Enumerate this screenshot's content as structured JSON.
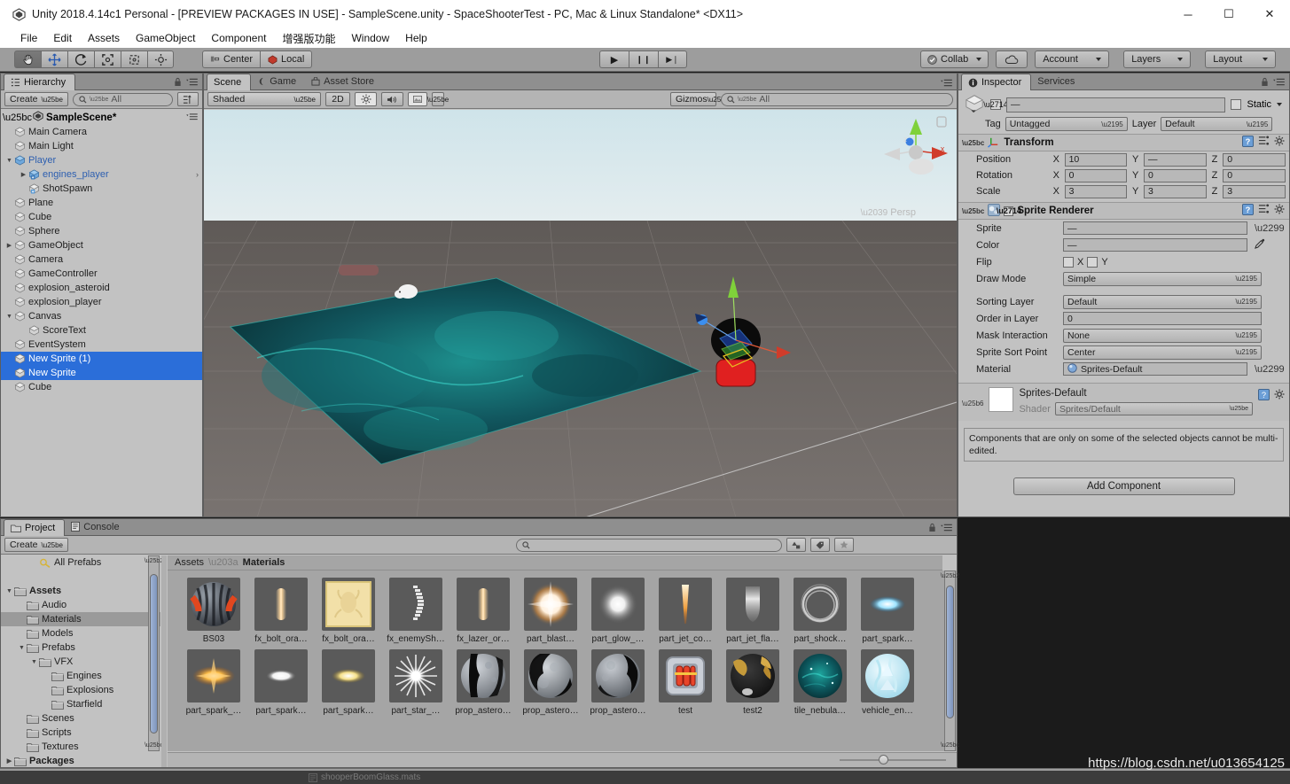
{
  "window": {
    "title": "Unity 2018.4.14c1 Personal - [PREVIEW PACKAGES IN USE] - SampleScene.unity - SpaceShooterTest - PC, Mac & Linux Standalone* <DX11>",
    "minimize": "─",
    "maximize": "☐",
    "close": "✕"
  },
  "menu": {
    "items": [
      "File",
      "Edit",
      "Assets",
      "GameObject",
      "Component",
      "增强版功能",
      "Window",
      "Help"
    ]
  },
  "toolbar": {
    "tools": [
      {
        "name": "hand-tool",
        "glyph": "✋",
        "active": true
      },
      {
        "name": "move-tool",
        "glyph": "✥",
        "active": false
      },
      {
        "name": "rotate-tool",
        "glyph": "↻",
        "active": false
      },
      {
        "name": "scale-tool",
        "glyph": "⤡",
        "active": false
      },
      {
        "name": "rect-tool",
        "glyph": "⬚",
        "active": false
      },
      {
        "name": "transform-tool",
        "glyph": "⬡",
        "active": false
      }
    ],
    "pivot_mode": "Center",
    "pivot_rotation": "Local",
    "play": "▶",
    "pause": "❙❙",
    "step": "▶❘",
    "collab": "Collab",
    "cloud": "☁",
    "account": "Account",
    "layers": "Layers",
    "layout": "Layout"
  },
  "hierarchy": {
    "tab": "Hierarchy",
    "create": "Create",
    "search_placeholder": "All",
    "scene_name": "SampleScene*",
    "items": [
      {
        "label": "Main Camera",
        "depth": 1,
        "arrow": "",
        "selected": false,
        "blue": false
      },
      {
        "label": "Main Light",
        "depth": 1,
        "arrow": "",
        "selected": false,
        "blue": false
      },
      {
        "label": "Player",
        "depth": 1,
        "arrow": "down",
        "selected": false,
        "blue": true
      },
      {
        "label": "engines_player",
        "depth": 2,
        "arrow": "right",
        "selected": false,
        "blue": true,
        "chevron": "›"
      },
      {
        "label": "ShotSpawn",
        "depth": 2,
        "arrow": "",
        "selected": false,
        "blue": false
      },
      {
        "label": "Plane",
        "depth": 1,
        "arrow": "",
        "selected": false,
        "blue": false
      },
      {
        "label": "Cube",
        "depth": 1,
        "arrow": "",
        "selected": false,
        "blue": false
      },
      {
        "label": "Sphere",
        "depth": 1,
        "arrow": "",
        "selected": false,
        "blue": false
      },
      {
        "label": "GameObject",
        "depth": 1,
        "arrow": "right",
        "selected": false,
        "blue": false
      },
      {
        "label": "Camera",
        "depth": 1,
        "arrow": "",
        "selected": false,
        "blue": false
      },
      {
        "label": "GameController",
        "depth": 1,
        "arrow": "",
        "selected": false,
        "blue": false
      },
      {
        "label": "explosion_asteroid",
        "depth": 1,
        "arrow": "",
        "selected": false,
        "blue": false
      },
      {
        "label": "explosion_player",
        "depth": 1,
        "arrow": "",
        "selected": false,
        "blue": false
      },
      {
        "label": "Canvas",
        "depth": 1,
        "arrow": "down",
        "selected": false,
        "blue": false
      },
      {
        "label": "ScoreText",
        "depth": 2,
        "arrow": "",
        "selected": false,
        "blue": false
      },
      {
        "label": "EventSystem",
        "depth": 1,
        "arrow": "",
        "selected": false,
        "blue": false
      },
      {
        "label": "New Sprite (1)",
        "depth": 1,
        "arrow": "",
        "selected": true,
        "blue": false
      },
      {
        "label": "New Sprite",
        "depth": 1,
        "arrow": "",
        "selected": true,
        "blue": false
      },
      {
        "label": "Cube",
        "depth": 1,
        "arrow": "",
        "selected": false,
        "blue": false
      }
    ]
  },
  "scene": {
    "tabs": [
      {
        "label": "Scene",
        "active": true
      },
      {
        "label": "Game",
        "active": false
      },
      {
        "label": "Asset Store",
        "active": false
      }
    ],
    "draw_mode": "Shaded",
    "two_d": "2D",
    "lighting_icon": "☀",
    "audio_icon": "◂))",
    "fx_icon": "⛰",
    "gizmos": "Gizmos",
    "search_placeholder": "All",
    "persp_label": "Persp",
    "axis_x": "x",
    "axis_y": "y",
    "axis_z": "z"
  },
  "inspector": {
    "tabs": [
      {
        "label": "Inspector",
        "active": true
      },
      {
        "label": "Services",
        "active": false
      }
    ],
    "enabled_checked": true,
    "name_value": "—",
    "static_label": "Static",
    "tag_label": "Tag",
    "tag_value": "Untagged",
    "layer_label": "Layer",
    "layer_value": "Default",
    "transform": {
      "title": "Transform",
      "rows": [
        {
          "label": "Position",
          "x": "10",
          "y": "—",
          "z": "0"
        },
        {
          "label": "Rotation",
          "x": "0",
          "y": "0",
          "z": "0"
        },
        {
          "label": "Scale",
          "x": "3",
          "y": "3",
          "z": "3"
        }
      ]
    },
    "sprite_renderer": {
      "title": "Sprite Renderer",
      "enabled": true,
      "sprite_label": "Sprite",
      "sprite_value": "—",
      "color_label": "Color",
      "color_value": "—",
      "flip_label": "Flip",
      "flip_x": "X",
      "flip_y": "Y",
      "draw_mode_label": "Draw Mode",
      "draw_mode_value": "Simple",
      "sorting_layer_label": "Sorting Layer",
      "sorting_layer_value": "Default",
      "order_label": "Order in Layer",
      "order_value": "0",
      "mask_label": "Mask Interaction",
      "mask_value": "None",
      "sort_point_label": "Sprite Sort Point",
      "sort_point_value": "Center",
      "material_label": "Material",
      "material_value": "Sprites-Default"
    },
    "material_preview": {
      "title": "Sprites-Default",
      "shader_label": "Shader",
      "shader_value": "Sprites/Default"
    },
    "multi_edit_note": "Components that are only on some of the selected objects cannot be multi-edited.",
    "add_component": "Add Component"
  },
  "project": {
    "tabs": [
      {
        "label": "Project",
        "active": true
      },
      {
        "label": "Console",
        "active": false
      }
    ],
    "create": "Create",
    "search_placeholder": "",
    "breadcrumb": [
      "Assets",
      "Materials"
    ],
    "tree": [
      {
        "label": "All Prefabs",
        "depth": 2,
        "arrow": "",
        "icon": "search",
        "bold": false,
        "selected": false
      },
      {
        "label": "",
        "depth": 0,
        "arrow": "",
        "icon": "none",
        "bold": false,
        "selected": false
      },
      {
        "label": "Assets",
        "depth": 0,
        "arrow": "down",
        "icon": "folder",
        "bold": true,
        "selected": false
      },
      {
        "label": "Audio",
        "depth": 1,
        "arrow": "",
        "icon": "folder",
        "bold": false,
        "selected": false
      },
      {
        "label": "Materials",
        "depth": 1,
        "arrow": "",
        "icon": "folder",
        "bold": false,
        "selected": true
      },
      {
        "label": "Models",
        "depth": 1,
        "arrow": "",
        "icon": "folder",
        "bold": false,
        "selected": false
      },
      {
        "label": "Prefabs",
        "depth": 1,
        "arrow": "down",
        "icon": "folder",
        "bold": false,
        "selected": false
      },
      {
        "label": "VFX",
        "depth": 2,
        "arrow": "down",
        "icon": "folder",
        "bold": false,
        "selected": false
      },
      {
        "label": "Engines",
        "depth": 3,
        "arrow": "",
        "icon": "folder",
        "bold": false,
        "selected": false
      },
      {
        "label": "Explosions",
        "depth": 3,
        "arrow": "",
        "icon": "folder",
        "bold": false,
        "selected": false
      },
      {
        "label": "Starfield",
        "depth": 3,
        "arrow": "",
        "icon": "folder",
        "bold": false,
        "selected": false
      },
      {
        "label": "Scenes",
        "depth": 1,
        "arrow": "",
        "icon": "folder",
        "bold": false,
        "selected": false
      },
      {
        "label": "Scripts",
        "depth": 1,
        "arrow": "",
        "icon": "folder",
        "bold": false,
        "selected": false
      },
      {
        "label": "Textures",
        "depth": 1,
        "arrow": "",
        "icon": "folder",
        "bold": false,
        "selected": false
      },
      {
        "label": "Packages",
        "depth": 0,
        "arrow": "right",
        "icon": "folder",
        "bold": true,
        "selected": false
      }
    ],
    "assets": [
      {
        "name": "BS03",
        "kind": "sphere-striped"
      },
      {
        "name": "fx_bolt_ora…",
        "kind": "bolt"
      },
      {
        "name": "fx_bolt_ora…",
        "kind": "tile-yellow"
      },
      {
        "name": "fx_enemySh…",
        "kind": "shield-strip"
      },
      {
        "name": "fx_lazer_or…",
        "kind": "bolt"
      },
      {
        "name": "part_blast…",
        "kind": "blast"
      },
      {
        "name": "part_glow_…",
        "kind": "glow"
      },
      {
        "name": "part_jet_co…",
        "kind": "jet-cone"
      },
      {
        "name": "part_jet_fla…",
        "kind": "jet-flame"
      },
      {
        "name": "part_shock…",
        "kind": "shockring"
      },
      {
        "name": "part_spark…",
        "kind": "spark-blue"
      },
      {
        "name": "part_spark_…",
        "kind": "spark-orange"
      },
      {
        "name": "part_spark…",
        "kind": "spark-white"
      },
      {
        "name": "part_spark…",
        "kind": "spark-yellow"
      },
      {
        "name": "part_star_…",
        "kind": "star"
      },
      {
        "name": "prop_astero…",
        "kind": "asteroid1"
      },
      {
        "name": "prop_astero…",
        "kind": "asteroid2"
      },
      {
        "name": "prop_astero…",
        "kind": "asteroid3"
      },
      {
        "name": "test",
        "kind": "test-crate"
      },
      {
        "name": "test2",
        "kind": "test-gold"
      },
      {
        "name": "tile_nebula…",
        "kind": "nebula"
      },
      {
        "name": "vehicle_en…",
        "kind": "vehicle"
      }
    ],
    "zoom_value": 40
  },
  "statusbar": {
    "message": "shooperBoomGlass.mats"
  },
  "watermark": "https://blog.csdn.net/u013654125",
  "colors": {
    "selection_blue": "#2b6ed9",
    "panel_gray": "#c2c2c2",
    "toolbar_gray": "#9d9d9d",
    "axis_x": "#d03c2a",
    "axis_y": "#7fd13a",
    "axis_z": "#3b7fe0"
  }
}
